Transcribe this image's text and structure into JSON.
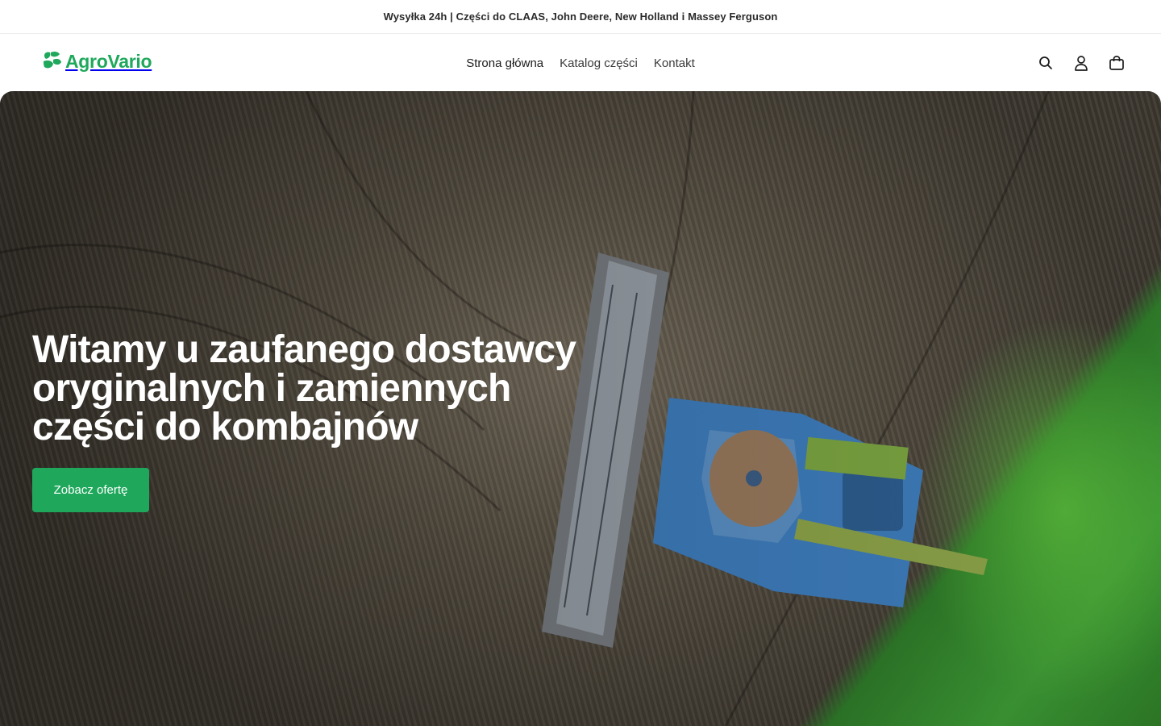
{
  "announcement": {
    "text": "Wysyłka 24h | Części do CLAAS, John Deere, New Holland i Massey Ferguson"
  },
  "header": {
    "logo_text": "AgroVario",
    "nav": [
      {
        "label": "Strona główna"
      },
      {
        "label": "Katalog części"
      },
      {
        "label": "Kontakt"
      }
    ],
    "icons": [
      "search-icon",
      "account-icon",
      "cart-icon"
    ]
  },
  "hero": {
    "title": "Witamy u zaufanego dostawcy oryginalnych i zamiennych części do kombajnów",
    "cta_label": "Zobacz ofertę"
  },
  "colors": {
    "brand": "#1fa85c",
    "text": "#222222"
  }
}
